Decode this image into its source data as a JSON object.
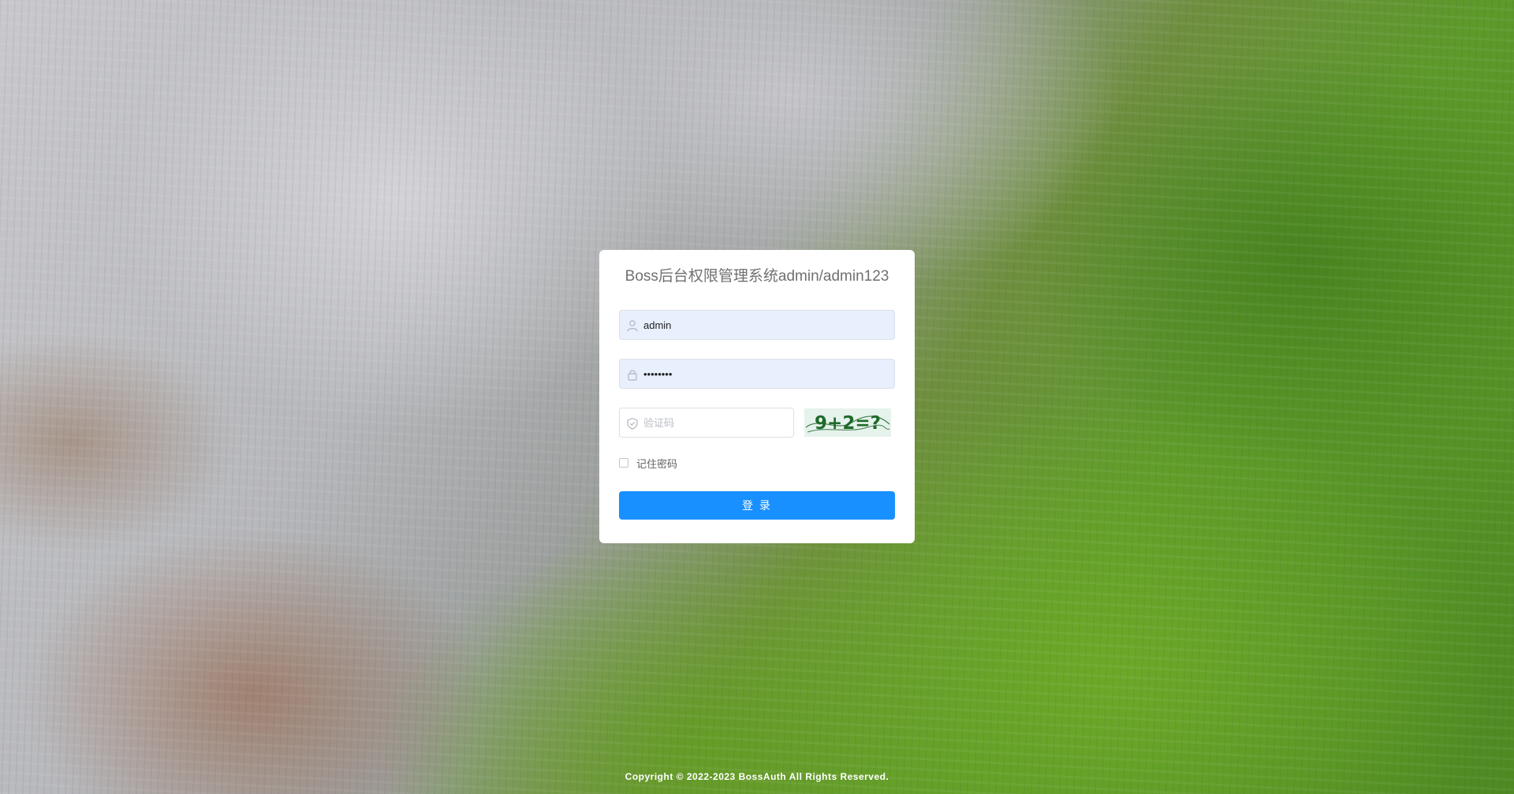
{
  "app": {
    "title": "Boss后台权限管理系统admin/admin123"
  },
  "form": {
    "username": {
      "value": "admin",
      "icon": "user-icon"
    },
    "password": {
      "value": "admin123",
      "icon": "lock-icon"
    },
    "captcha": {
      "placeholder": "验证码",
      "value": "",
      "icon": "shield-check-icon",
      "image_text": "9+2=?"
    },
    "remember": {
      "label": "记住密码",
      "checked": false
    },
    "submit_label": "登 录"
  },
  "footer": {
    "copyright": "Copyright © 2022-2023 BossAuth All Rights Reserved."
  },
  "colors": {
    "primary": "#1890ff",
    "title_text": "#707070",
    "autofill_bg": "#e8f0fe",
    "captcha_text": "#1e6b2a"
  }
}
